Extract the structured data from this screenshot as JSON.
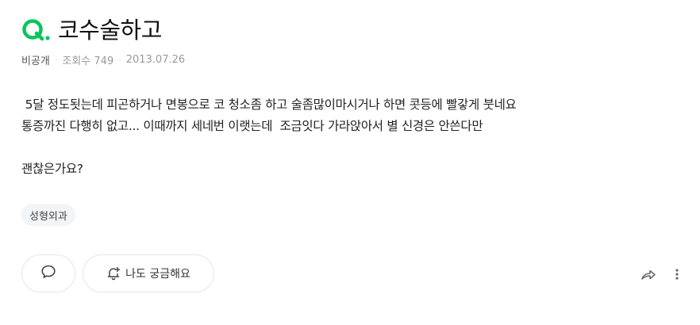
{
  "question": {
    "q_label": "Q.",
    "title": "코수술하고",
    "visibility": "비공개",
    "views_label": "조회수 749",
    "date": "2013.07.26",
    "body_lines": [
      " 5달 정도됫는데 피곤하거나 면봉으로 코 청소좀 하고 술좀많이마시거나 하면 콧등에 빨갛게 붓네요",
      "통증까진 다행히 없고... 이때까지 세네번 이랫는데  조금잇다 가라앉아서 별 신경은 안쓴다만",
      "괜찮은가요?"
    ],
    "tag": "성형외과"
  },
  "actions": {
    "comment_icon": "speech-bubble-icon",
    "curious_label": "나도 궁금해요",
    "curious_icon": "bell-plus-icon",
    "share_icon": "share-arrow-icon",
    "more_icon": "more-vertical-icon"
  },
  "colors": {
    "accent_green": "#03c75a",
    "text": "#222222",
    "meta": "#999999"
  }
}
